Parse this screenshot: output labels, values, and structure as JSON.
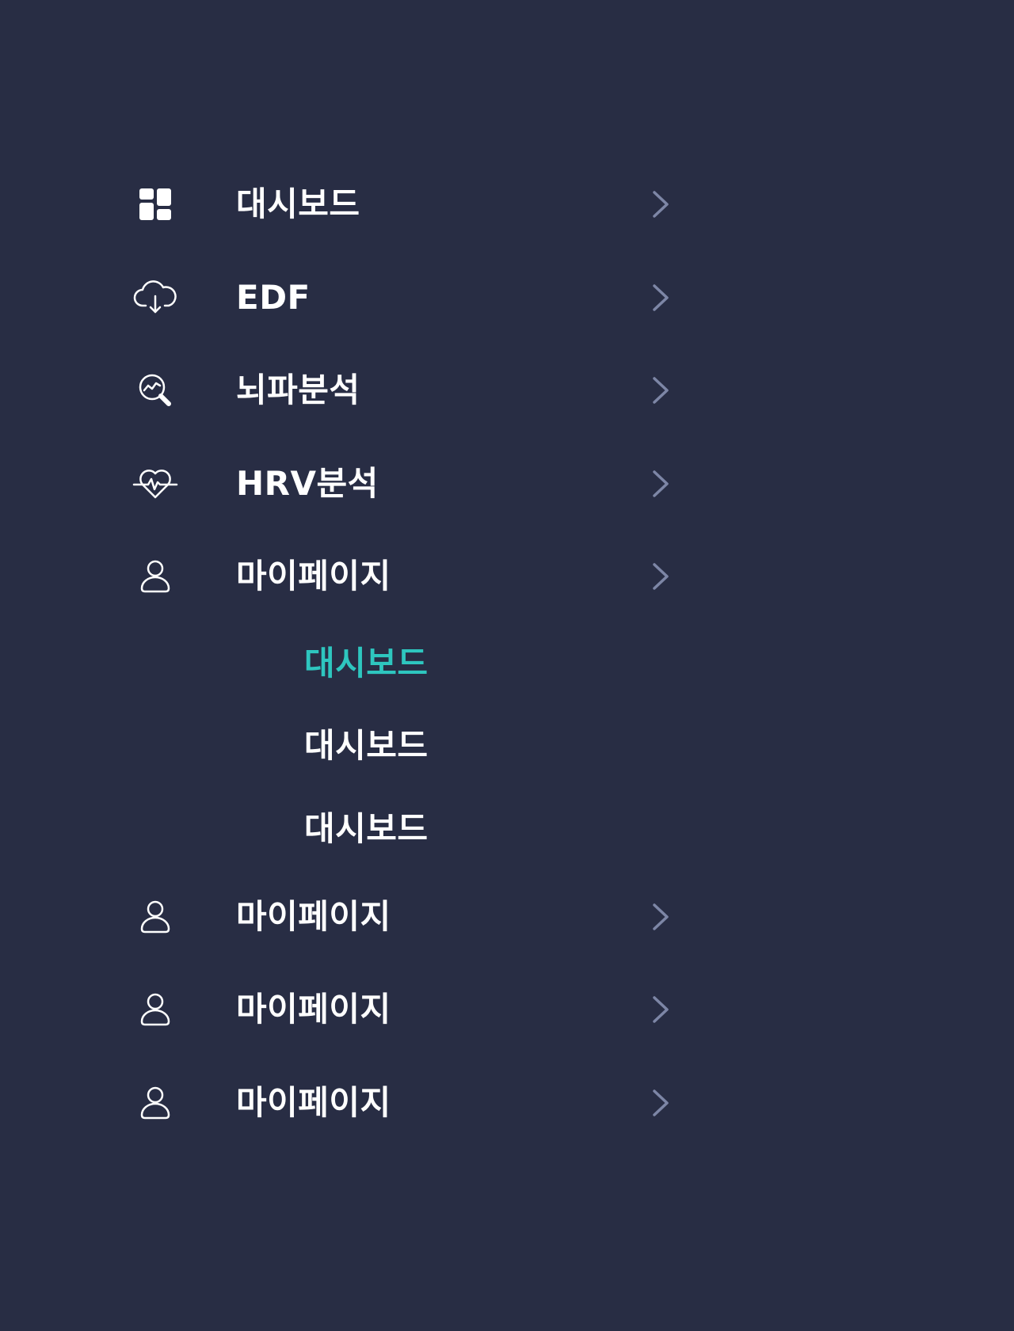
{
  "colors": {
    "background": "#282d44",
    "text": "#ffffff",
    "active": "#2ec6bf",
    "chevron": "#7d86a6"
  },
  "menu": {
    "items": [
      {
        "label": "대시보드",
        "icon": "dashboard-grid-icon"
      },
      {
        "label": "EDF",
        "icon": "cloud-download-icon"
      },
      {
        "label": "뇌파분석",
        "icon": "search-analytics-icon"
      },
      {
        "label": "HRV분석",
        "icon": "heart-pulse-icon"
      },
      {
        "label": "마이페이지",
        "icon": "user-icon",
        "expanded": true
      },
      {
        "label": "마이페이지",
        "icon": "user-icon"
      },
      {
        "label": "마이페이지",
        "icon": "user-icon"
      },
      {
        "label": "마이페이지",
        "icon": "user-icon"
      }
    ],
    "submenu": [
      {
        "label": "대시보드",
        "active": true
      },
      {
        "label": "대시보드",
        "active": false
      },
      {
        "label": "대시보드",
        "active": false
      }
    ]
  }
}
